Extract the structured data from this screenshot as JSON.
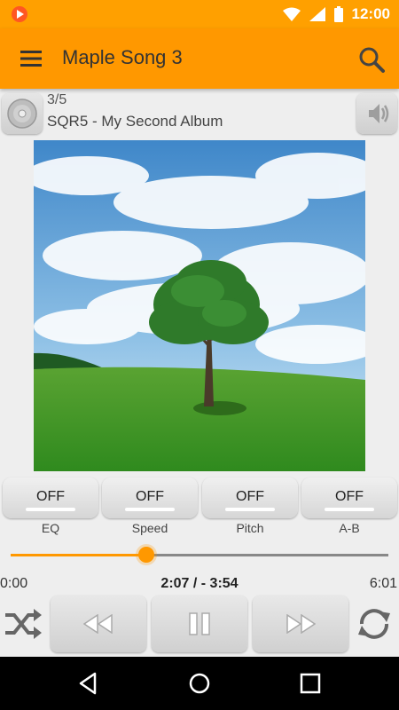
{
  "status": {
    "time": "12:00"
  },
  "appbar": {
    "title": "Maple Song 3"
  },
  "track": {
    "count": "3/5",
    "info": "SQR5 - My Second Album"
  },
  "toggles": [
    {
      "state": "OFF",
      "label": "EQ"
    },
    {
      "state": "OFF",
      "label": "Speed"
    },
    {
      "state": "OFF",
      "label": "Pitch"
    },
    {
      "state": "OFF",
      "label": "A-B"
    }
  ],
  "seek": {
    "progress_fraction": 0.36
  },
  "time": {
    "start": "0:00",
    "current": "2:07 / - 3:54",
    "end": "6:01"
  },
  "colors": {
    "accent": "#ff9800",
    "statusbar": "#ffa000"
  },
  "icons": {
    "menu": "hamburger-icon",
    "search": "search-icon",
    "cd": "disc-icon",
    "volume": "speaker-icon",
    "shuffle": "shuffle-icon",
    "rewind": "rewind-icon",
    "pause": "pause-icon",
    "forward": "fast-forward-icon",
    "repeat": "repeat-icon"
  }
}
